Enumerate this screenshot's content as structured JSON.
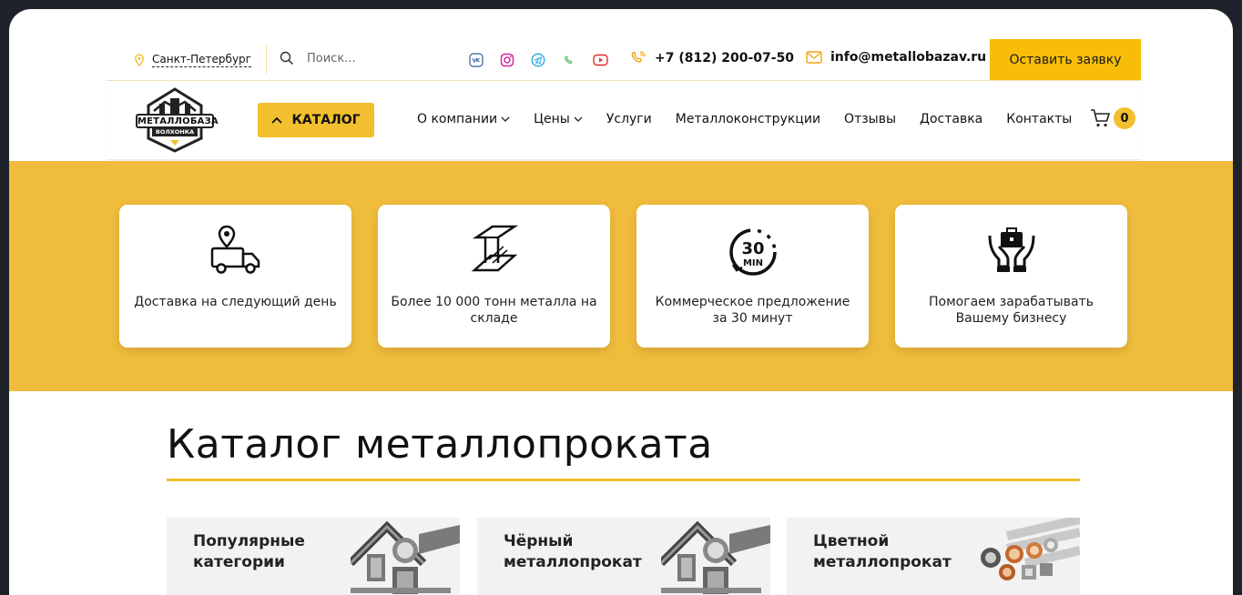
{
  "topbar": {
    "city": "Санкт-Петербург",
    "search_placeholder": "Поиск...",
    "socials": [
      "vk-icon",
      "instagram-icon",
      "telegram-icon",
      "whatsapp-icon",
      "youtube-icon"
    ],
    "phone": "+7 (812) 200-07-50",
    "email": "info@metallobazav.ru",
    "cta": "Оставить заявку"
  },
  "logo": {
    "line1": "МЕТАЛЛОБАЗА",
    "line2": "ВОЛХОНКА"
  },
  "nav": {
    "catalog": "КАТАЛОГ",
    "items": [
      {
        "label": "О компании",
        "dropdown": true
      },
      {
        "label": "Цены",
        "dropdown": true
      },
      {
        "label": "Услуги",
        "dropdown": false
      },
      {
        "label": "Металлоконструкции",
        "dropdown": false
      },
      {
        "label": "Отзывы",
        "dropdown": false
      },
      {
        "label": "Доставка",
        "dropdown": false
      },
      {
        "label": "Контакты",
        "dropdown": false
      }
    ],
    "cart_count": "0"
  },
  "features": [
    {
      "icon": "delivery-truck-icon",
      "text": "Доставка на следующий день"
    },
    {
      "icon": "steel-beam-icon",
      "text": "Более 10 000 тонн металла на складе"
    },
    {
      "icon": "thirty-min-icon",
      "text": "Коммерческое предложение за 30 минут",
      "badge": "30",
      "badge_sub": "MIN"
    },
    {
      "icon": "hands-briefcase-icon",
      "text": "Помогаем зарабатывать Вашему бизнесу"
    }
  ],
  "catalog": {
    "title": "Каталог металлопроката",
    "cards": [
      {
        "line1": "Популярные",
        "line2": "категории"
      },
      {
        "line1": "Чёрный",
        "line2": "металлопрокат"
      },
      {
        "line1": "Цветной",
        "line2": "металлопрокат"
      }
    ]
  },
  "colors": {
    "accent": "#f2bf2f",
    "band": "#f0bc3c",
    "cta": "#f7bd08",
    "frame": "#1e232b"
  }
}
